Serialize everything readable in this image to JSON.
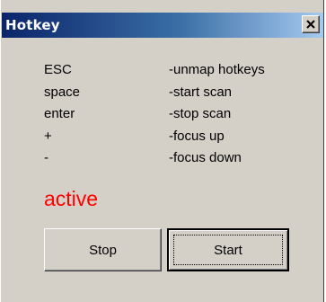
{
  "window": {
    "title": "Hotkey",
    "close_icon": "close-x-icon"
  },
  "hotkeys": [
    {
      "key": "ESC",
      "description": "-unmap hotkeys"
    },
    {
      "key": "space",
      "description": "-start scan"
    },
    {
      "key": "enter",
      "description": "-stop scan"
    },
    {
      "key": "+",
      "description": "-focus up"
    },
    {
      "key": "-",
      "description": "-focus down"
    }
  ],
  "status": {
    "text": "active",
    "color": "#ff0000"
  },
  "buttons": {
    "stop_label": "Stop",
    "start_label": "Start"
  },
  "colors": {
    "titlebar_start": "#0a246a",
    "titlebar_end": "#a6caf0",
    "face": "#d4d0c8"
  }
}
